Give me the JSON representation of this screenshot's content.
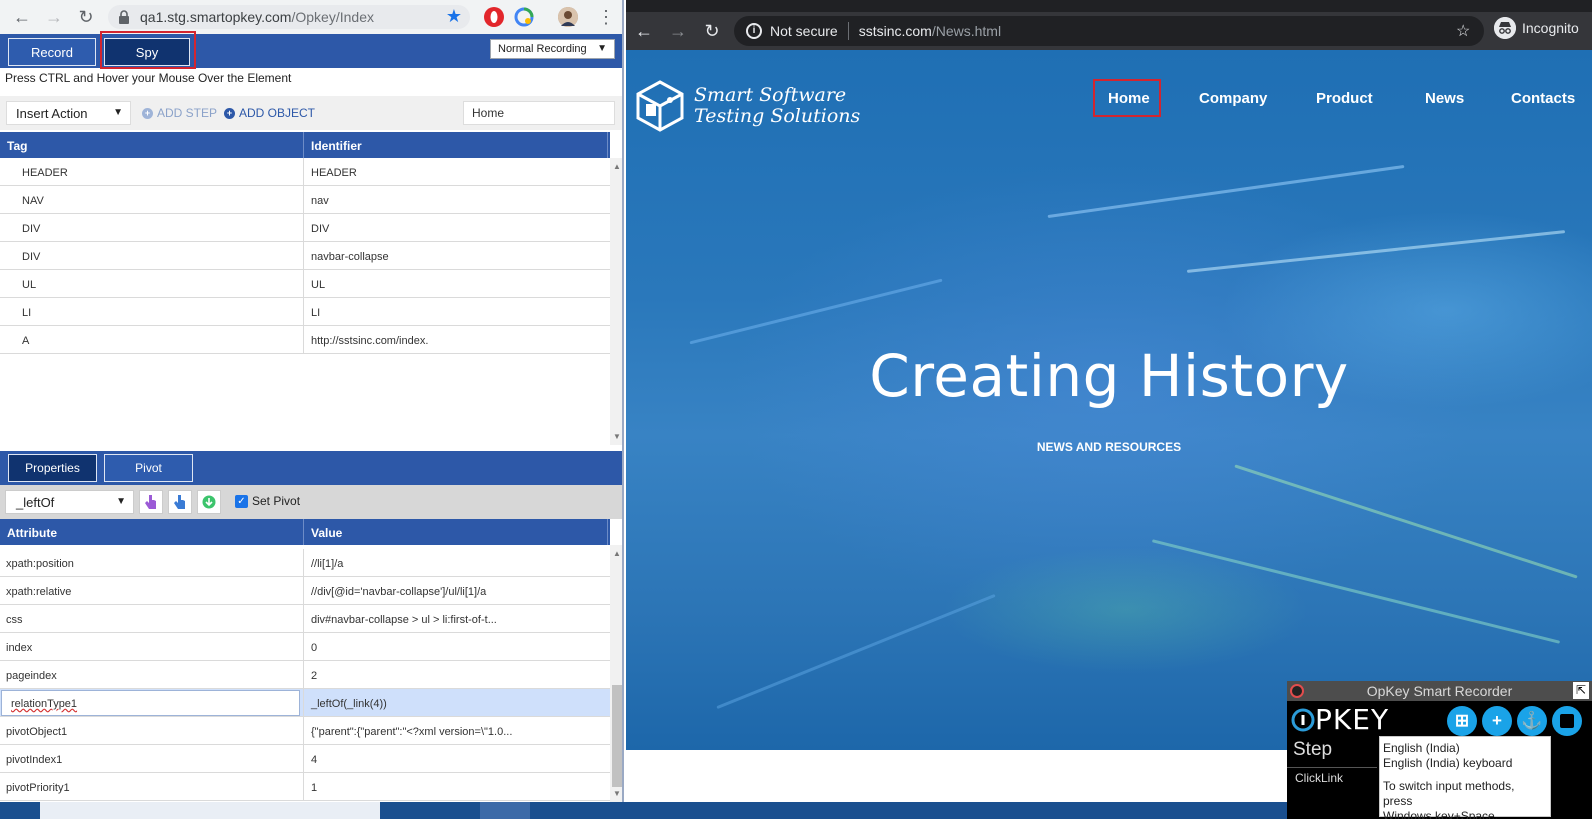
{
  "left_browser": {
    "url_host": "qa1.stg.smartopkey.com",
    "url_path": "/Opkey/Index"
  },
  "toolbar": {
    "record_label": "Record",
    "spy_label": "Spy",
    "recording_mode": "Normal Recording",
    "hint": "Press CTRL and Hover your Mouse Over the Element"
  },
  "actions": {
    "insert_action": "Insert Action",
    "add_step": "ADD STEP",
    "add_object": "ADD OBJECT",
    "search_value": "Home"
  },
  "dom_grid": {
    "headers": [
      "Tag",
      "Identifier"
    ],
    "rows": [
      [
        "HEADER",
        "HEADER"
      ],
      [
        "NAV",
        "nav"
      ],
      [
        "DIV",
        "DIV"
      ],
      [
        "DIV",
        "navbar-collapse"
      ],
      [
        "UL",
        "UL"
      ],
      [
        "LI",
        "LI"
      ],
      [
        "A",
        "http://sstsinc.com/index."
      ]
    ]
  },
  "props_tabs": {
    "properties_label": "Properties",
    "pivot_label": "Pivot"
  },
  "pivot": {
    "relation": "_leftOf",
    "set_pivot_label": "Set Pivot",
    "set_pivot_checked": true
  },
  "attr_grid": {
    "headers": [
      "Attribute",
      "Value"
    ],
    "rows": [
      [
        "xpath:position",
        "//li[1]/a"
      ],
      [
        "xpath:relative",
        "//div[@id='navbar-collapse']/ul/li[1]/a"
      ],
      [
        "css",
        "div#navbar-collapse > ul > li:first-of-t..."
      ],
      [
        "index",
        "0"
      ],
      [
        "pageindex",
        "2"
      ],
      [
        "relationType1",
        "_leftOf(_link(4))"
      ],
      [
        "pivotObject1",
        "{\"parent\":{\"parent\":\"<?xml version=\\\"1.0..."
      ],
      [
        "pivotIndex1",
        "4"
      ],
      [
        "pivotPriority1",
        "1"
      ]
    ],
    "selected_row": 5
  },
  "right_browser": {
    "security": "Not secure",
    "url_host": "sstsinc.com",
    "url_path": "/News.html",
    "mode": "Incognito"
  },
  "site": {
    "logo_line1": "Smart Software",
    "logo_line2": "Testing Solutions",
    "nav": [
      "Home",
      "Company",
      "Product",
      "News",
      "Contacts"
    ],
    "hero_title": "Creating History",
    "hero_subtitle": "NEWS AND RESOURCES"
  },
  "recorder": {
    "title": "OpKey Smart Recorder",
    "logo": "PKEY",
    "step_label": "Step",
    "step_value": "ClickLink"
  },
  "ime_tooltip": {
    "line1": "English (India)",
    "line2": "English (India) keyboard",
    "line3": "To switch input methods, press",
    "line4": "Windows key+Space."
  },
  "colors": {
    "opkey_blue": "#2d58a8",
    "active_tab": "#10336f",
    "highlight_red": "#d3252f",
    "selected_row": "#cfe0fb"
  }
}
